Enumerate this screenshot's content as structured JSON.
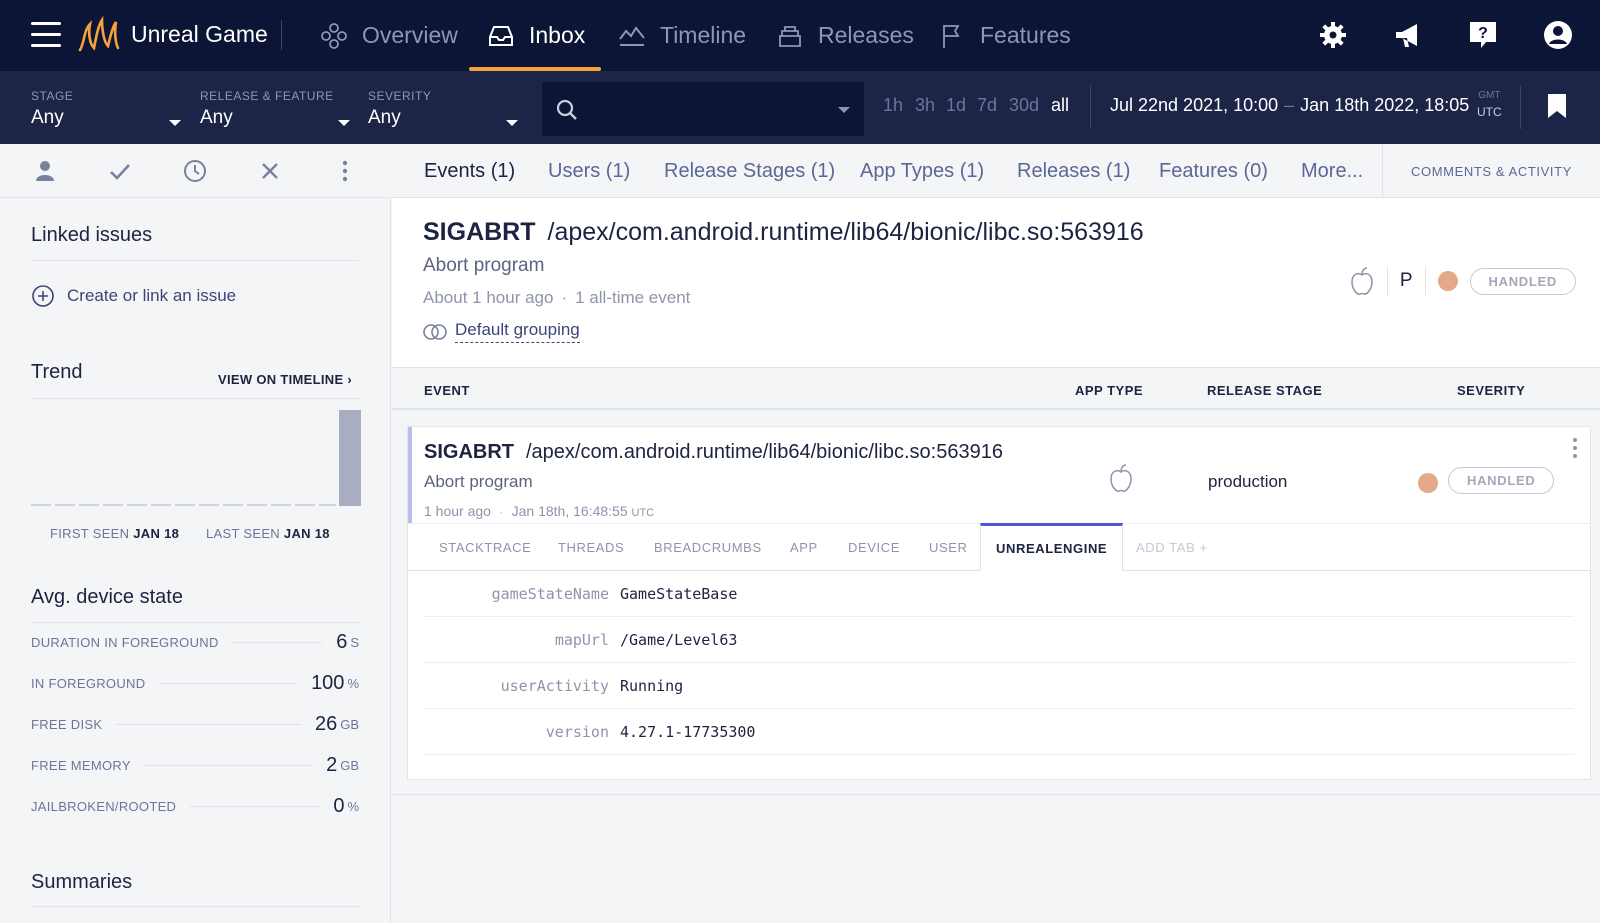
{
  "nav": {
    "brand": "Unreal Game",
    "items": [
      {
        "label": "Overview",
        "icon": "overview-icon"
      },
      {
        "label": "Inbox",
        "icon": "inbox-icon",
        "active": true
      },
      {
        "label": "Timeline",
        "icon": "timeline-icon"
      },
      {
        "label": "Releases",
        "icon": "releases-icon"
      },
      {
        "label": "Features",
        "icon": "flag-icon"
      }
    ],
    "right_icons": [
      "gear-icon",
      "megaphone-icon",
      "help-icon",
      "user-icon"
    ],
    "accent_color": "#f6a13b"
  },
  "filters": {
    "stage": {
      "label": "STAGE",
      "value": "Any"
    },
    "release_feature": {
      "label": "RELEASE & FEATURE",
      "value": "Any"
    },
    "severity": {
      "label": "SEVERITY",
      "value": "Any"
    },
    "search_placeholder": "",
    "ranges": [
      "1h",
      "3h",
      "1d",
      "7d",
      "30d",
      "all"
    ],
    "active_range": "all",
    "date_start": "Jul 22nd 2021, 10:00",
    "date_sep": "–",
    "date_end": "Jan 18th 2022, 18:05",
    "tz_top": "GMT",
    "tz_bottom": "UTC"
  },
  "sidebar": {
    "actions": [
      "assign-user-icon",
      "check-icon",
      "snooze-clock-icon",
      "close-icon",
      "more-vertical-icon"
    ],
    "linked_issues_title": "Linked issues",
    "create_link": "Create or link an issue",
    "trend_title": "Trend",
    "view_on_timeline": "VIEW ON TIMELINE ›",
    "first_seen_label": "FIRST SEEN",
    "first_seen_value": "JAN 18",
    "last_seen_label": "LAST SEEN",
    "last_seen_value": "JAN 18",
    "device_state_title": "Avg. device state",
    "stats": [
      {
        "key": "DURATION IN FOREGROUND",
        "value": "6",
        "unit": "S"
      },
      {
        "key": "IN FOREGROUND",
        "value": "100",
        "unit": "%"
      },
      {
        "key": "FREE DISK",
        "value": "26",
        "unit": "GB"
      },
      {
        "key": "FREE MEMORY",
        "value": "2",
        "unit": "GB"
      },
      {
        "key": "JAILBROKEN/ROOTED",
        "value": "0",
        "unit": "%"
      }
    ],
    "summaries_title": "Summaries"
  },
  "main_tabs": {
    "items": [
      "Events (1)",
      "Users (1)",
      "Release Stages (1)",
      "App Types (1)",
      "Releases (1)",
      "Features (0)",
      "More..."
    ],
    "active": "Events (1)",
    "comments": "COMMENTS & ACTIVITY"
  },
  "error": {
    "class": "SIGABRT",
    "location": "/apex/com.android.runtime/lib64/bionic/libc.so:563916",
    "message": "Abort program",
    "time_ago": "About 1 hour ago",
    "dot": "·",
    "count_text": "1 all-time event",
    "grouping": "Default grouping",
    "platform_letter": "P",
    "handled": "HANDLED",
    "severity_color": "#e3a989"
  },
  "events_table": {
    "headers": {
      "event": "EVENT",
      "app_type": "APP TYPE",
      "release_stage": "RELEASE STAGE",
      "severity": "SEVERITY"
    },
    "row": {
      "class": "SIGABRT",
      "location": "/apex/com.android.runtime/lib64/bionic/libc.so:563916",
      "message": "Abort program",
      "time_ago": "1 hour ago",
      "dot": "·",
      "timestamp": "Jan 18th, 16:48:55",
      "tz": "UTC",
      "release_stage": "production",
      "handled": "HANDLED"
    },
    "tabs": [
      "STACKTRACE",
      "THREADS",
      "BREADCRUMBS",
      "APP",
      "DEVICE",
      "USER",
      "UNREALENGINE",
      "ADD TAB +"
    ],
    "active_tab": "UNREALENGINE",
    "details": [
      {
        "key": "gameStateName",
        "value": "GameStateBase"
      },
      {
        "key": "mapUrl",
        "value": "/Game/Level63"
      },
      {
        "key": "userActivity",
        "value": "Running"
      },
      {
        "key": "version",
        "value": "4.27.1-17735300"
      }
    ]
  }
}
